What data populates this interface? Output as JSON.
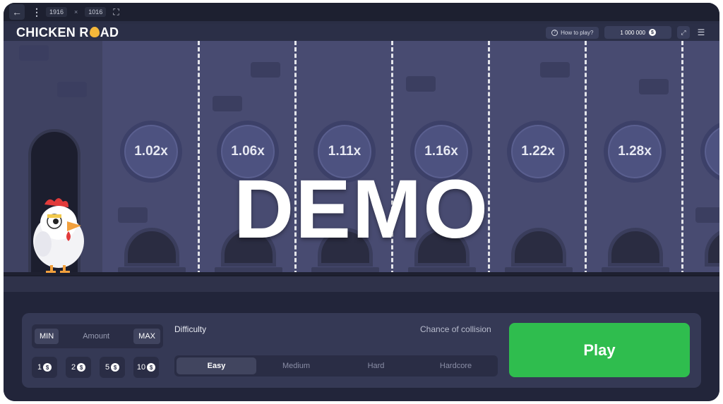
{
  "devtools": {
    "back_icon": "arrow-left-icon",
    "menu_icon": "vertical-dots-icon",
    "width": "1916",
    "separator": "×",
    "height": "1016",
    "fullscreen_icon": "fullscreen-icon"
  },
  "header": {
    "logo_part1": "CHICKEN R",
    "logo_part2": "AD",
    "how_to_play": "How to play?",
    "balance": "1 000 000",
    "currency_symbol": "$"
  },
  "scene": {
    "multipliers": [
      "1.02x",
      "1.06x",
      "1.11x",
      "1.16x",
      "1.22x",
      "1.28x"
    ],
    "watermark": "DEMO"
  },
  "controls": {
    "min_label": "MIN",
    "amount_label": "Amount",
    "max_label": "MAX",
    "chips": [
      "1",
      "2",
      "5",
      "10"
    ],
    "difficulty_label": "Difficulty",
    "chance_label": "Chance of collision",
    "difficulties": [
      "Easy",
      "Medium",
      "Hard",
      "Hardcore"
    ],
    "selected_difficulty": "Easy",
    "play_label": "Play"
  },
  "colors": {
    "play_button": "#2fbd4e",
    "scene_background": "#484b71",
    "panel": "#353955"
  }
}
